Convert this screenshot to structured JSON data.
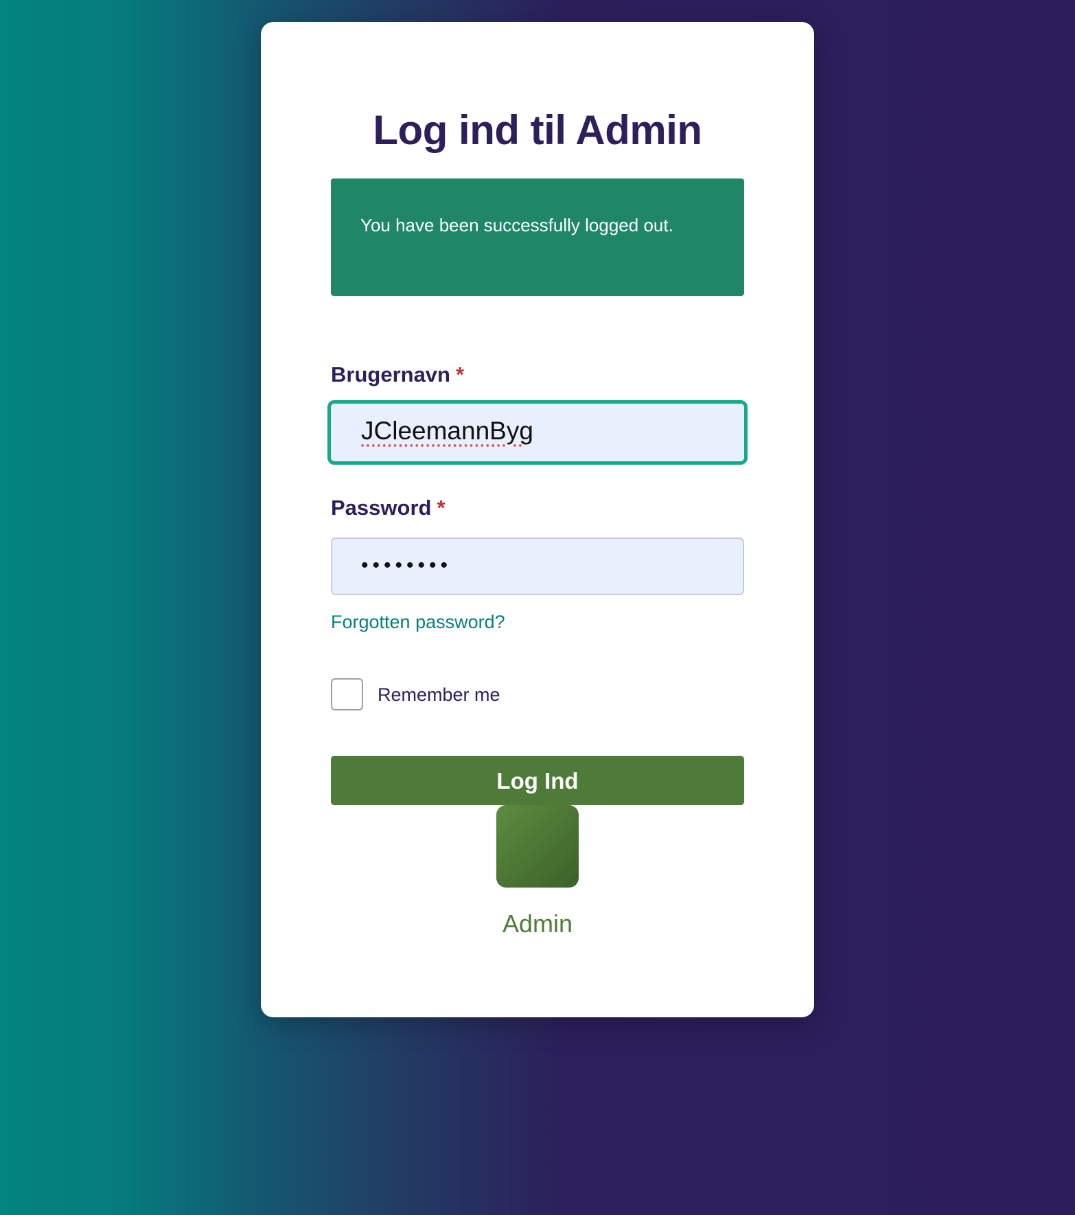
{
  "page": {
    "title": "Log ind til Admin"
  },
  "alert": {
    "message": "You have been successfully logged out."
  },
  "form": {
    "username_label": "Brugernavn",
    "username_value": "JCleemannByg",
    "password_label": "Password",
    "password_value": "••••••••",
    "required_marker": "*",
    "forgot_link": "Forgotten password?",
    "remember_label": "Remember me",
    "remember_checked": false,
    "submit_label": "Log Ind"
  },
  "brand": {
    "name": "Admin"
  },
  "colors": {
    "primary": "#2c1f5c",
    "success": "#1f8767",
    "button": "#4f7b39",
    "focus": "#17a88a",
    "link": "#05807c",
    "required": "#c0323c"
  }
}
